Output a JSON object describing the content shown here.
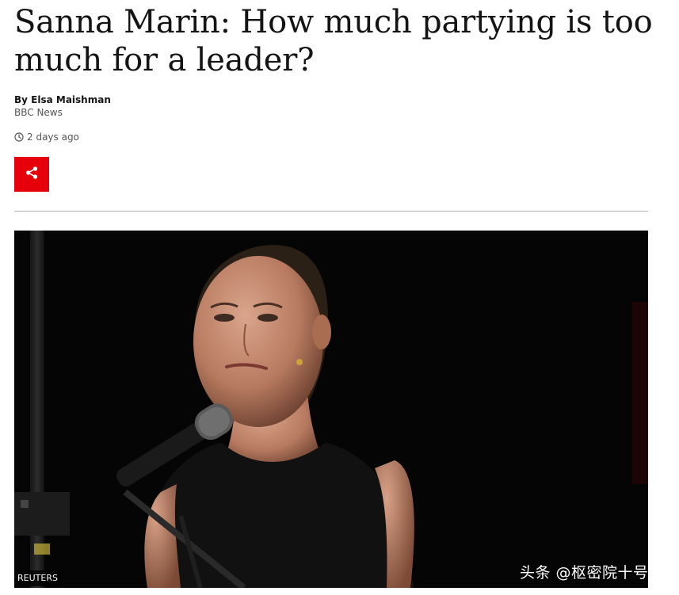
{
  "article": {
    "headline": "Sanna Marin: How much partying is too much for a leader?",
    "author": "By Elsa Maishman",
    "organization": "BBC News",
    "timestamp": "2 days ago",
    "share_icon": "share-icon",
    "clock_icon": "clock-icon"
  },
  "hero_image": {
    "credit": "REUTERS"
  },
  "watermark": {
    "text": "头条 @枢密院十号"
  },
  "colors": {
    "share_button": "#e6000a",
    "divider": "#b0b0b0",
    "meta_text": "#545658"
  }
}
